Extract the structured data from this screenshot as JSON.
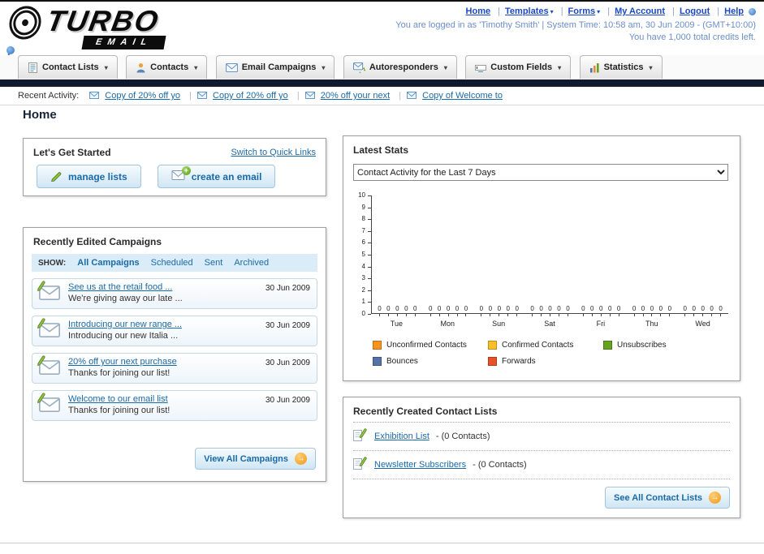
{
  "header": {
    "logo": {
      "title": "TURBO",
      "subtitle": "EMAIL"
    },
    "nav_links": [
      "Home",
      "Templates",
      "Forms",
      "My Account",
      "Logout",
      "Help"
    ],
    "login_info": "You are logged in as 'Timothy Smith' | System Time: 10:58 am, 30 Jun 2009 - (GMT+10:00)",
    "credits_info": "You have 1,000 total credits left."
  },
  "nav": {
    "tabs": [
      {
        "label": "Contact Lists",
        "icon": "contact-lists-icon"
      },
      {
        "label": "Contacts",
        "icon": "contacts-icon"
      },
      {
        "label": "Email Campaigns",
        "icon": "email-campaigns-icon"
      },
      {
        "label": "Autoresponders",
        "icon": "autoresponders-icon"
      },
      {
        "label": "Custom Fields",
        "icon": "custom-fields-icon"
      },
      {
        "label": "Statistics",
        "icon": "statistics-icon"
      }
    ]
  },
  "recent_activity": {
    "label": "Recent Activity:",
    "items": [
      "Copy of 20% off yo",
      "Copy of 20% off yo",
      "20% off your next",
      "Copy of Welcome to"
    ]
  },
  "page_title": "Home",
  "get_started": {
    "title": "Let's Get Started",
    "switch_link": "Switch to Quick Links",
    "manage_lists_label": "manage lists",
    "create_email_label": "create an email"
  },
  "campaigns": {
    "title": "Recently Edited Campaigns",
    "show_label": "SHOW:",
    "filters": [
      {
        "label": "All Campaigns",
        "active": true
      },
      {
        "label": "Scheduled",
        "active": false
      },
      {
        "label": "Sent",
        "active": false
      },
      {
        "label": "Archived",
        "active": false
      }
    ],
    "items": [
      {
        "title": "See us at the retail food ...",
        "subtitle": "We're giving away our late ...",
        "date": "30 Jun 2009"
      },
      {
        "title": "Introducing our new range ...",
        "subtitle": "Introducing our new Italia ...",
        "date": "30 Jun 2009"
      },
      {
        "title": "20% off your next purchase",
        "subtitle": "Thanks for joining our list!",
        "date": "30 Jun 2009"
      },
      {
        "title": "Welcome to our email list",
        "subtitle": "Thanks for joining our list!",
        "date": "30 Jun 2009"
      }
    ],
    "view_all_label": "View All Campaigns"
  },
  "latest_stats": {
    "title": "Latest Stats",
    "dropdown_value": "Contact Activity for the Last 7 Days"
  },
  "chart_data": {
    "type": "bar",
    "title": "Contact Activity for the Last 7 Days",
    "categories": [
      "Tue",
      "Mon",
      "Sun",
      "Sat",
      "Fri",
      "Thu",
      "Wed"
    ],
    "series": [
      {
        "name": "Unconfirmed Contacts",
        "color": "#f7941d",
        "values": [
          0,
          0,
          0,
          0,
          0,
          0,
          0
        ]
      },
      {
        "name": "Confirmed Contacts",
        "color": "#fdbe27",
        "values": [
          0,
          0,
          0,
          0,
          0,
          0,
          0
        ]
      },
      {
        "name": "Unsubscribes",
        "color": "#64a21f",
        "values": [
          0,
          0,
          0,
          0,
          0,
          0,
          0
        ]
      },
      {
        "name": "Bounces",
        "color": "#5572a7",
        "values": [
          0,
          0,
          0,
          0,
          0,
          0,
          0
        ]
      },
      {
        "name": "Forwards",
        "color": "#e8502a",
        "values": [
          0,
          0,
          0,
          0,
          0,
          0,
          0
        ]
      }
    ],
    "xlabel": "",
    "ylabel": "",
    "ylim": [
      0,
      10
    ],
    "yticks": [
      0,
      1,
      2,
      3,
      4,
      5,
      6,
      7,
      8,
      9,
      10
    ],
    "grid": false,
    "legend_position": "bottom"
  },
  "contact_lists": {
    "title": "Recently Created Contact Lists",
    "items": [
      {
        "name": "Exhibition List",
        "meta": "- (0 Contacts)"
      },
      {
        "name": "Newsletter Subscribers",
        "meta": "- (0 Contacts)"
      }
    ],
    "see_all_label": "See All Contact Lists"
  }
}
